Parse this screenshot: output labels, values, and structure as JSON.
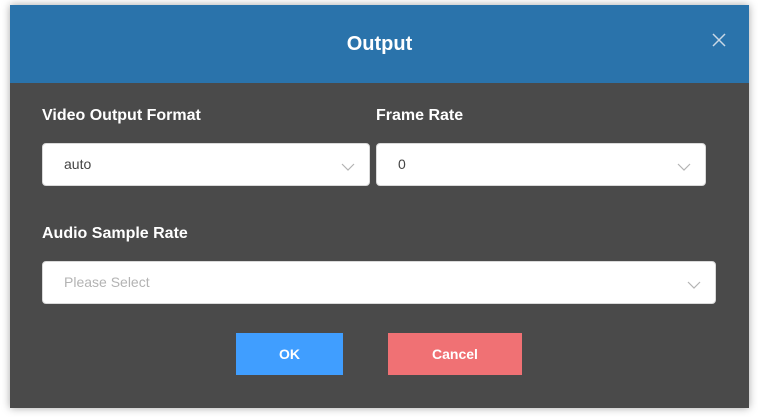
{
  "dialog": {
    "title": "Output",
    "close_icon": "close-icon"
  },
  "fields": {
    "video_output_format": {
      "label": "Video Output Format",
      "value": "auto"
    },
    "frame_rate": {
      "label": "Frame Rate",
      "value": "0"
    },
    "audio_sample_rate": {
      "label": "Audio Sample Rate",
      "placeholder": "Please Select"
    }
  },
  "buttons": {
    "ok_label": "OK",
    "cancel_label": "Cancel"
  },
  "colors": {
    "header": "#2a73ab",
    "body": "#4a4a4a",
    "ok": "#409eff",
    "cancel": "#f07174"
  }
}
